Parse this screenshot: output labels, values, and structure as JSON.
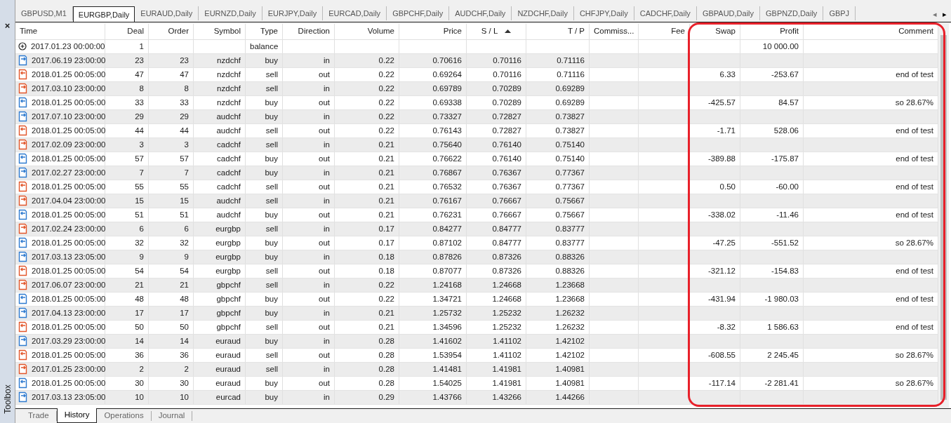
{
  "chart_tabs": [
    {
      "label": "GBPUSD,M1",
      "selected": false
    },
    {
      "label": "EURGBP,Daily",
      "selected": true
    },
    {
      "label": "EURAUD,Daily",
      "selected": false
    },
    {
      "label": "EURNZD,Daily",
      "selected": false
    },
    {
      "label": "EURJPY,Daily",
      "selected": false
    },
    {
      "label": "EURCAD,Daily",
      "selected": false
    },
    {
      "label": "GBPCHF,Daily",
      "selected": false
    },
    {
      "label": "AUDCHF,Daily",
      "selected": false
    },
    {
      "label": "NZDCHF,Daily",
      "selected": false
    },
    {
      "label": "CHFJPY,Daily",
      "selected": false
    },
    {
      "label": "CADCHF,Daily",
      "selected": false
    },
    {
      "label": "GBPAUD,Daily",
      "selected": false
    },
    {
      "label": "GBPNZD,Daily",
      "selected": false
    },
    {
      "label": "GBPJ",
      "selected": false
    }
  ],
  "tab_scroll": {
    "left": "◂",
    "right": "▸"
  },
  "panel": {
    "close": "×",
    "title": "Toolbox"
  },
  "table": {
    "columns": [
      {
        "label": "Time"
      },
      {
        "label": "Deal"
      },
      {
        "label": "Order"
      },
      {
        "label": "Symbol"
      },
      {
        "label": "Type"
      },
      {
        "label": "Direction"
      },
      {
        "label": "Volume"
      },
      {
        "label": "Price"
      },
      {
        "label": "S / L",
        "sorted": true
      },
      {
        "label": "T / P"
      },
      {
        "label": "Commiss..."
      },
      {
        "label": "Fee"
      },
      {
        "label": "Swap"
      },
      {
        "label": "Profit"
      },
      {
        "label": "Comment"
      }
    ],
    "rows": [
      {
        "kind": "balance",
        "time": "2017.01.23 00:00:00",
        "deal": "1",
        "type": "balance",
        "profit": "10 000.00"
      },
      {
        "kind": "deal",
        "time": "2017.06.19 23:00:00",
        "deal": "23",
        "order": "23",
        "symbol": "nzdchf",
        "type": "buy",
        "direction": "in",
        "volume": "0.22",
        "price": "0.70616",
        "sl": "0.70116",
        "tp": "0.71116"
      },
      {
        "kind": "deal",
        "time": "2018.01.25 00:05:00",
        "deal": "47",
        "order": "47",
        "symbol": "nzdchf",
        "type": "sell",
        "direction": "out",
        "volume": "0.22",
        "price": "0.69264",
        "sl": "0.70116",
        "tp": "0.71116",
        "swap": "6.33",
        "profit": "-253.67",
        "comment": "end of test"
      },
      {
        "kind": "deal",
        "time": "2017.03.10 23:00:00",
        "deal": "8",
        "order": "8",
        "symbol": "nzdchf",
        "type": "sell",
        "direction": "in",
        "volume": "0.22",
        "price": "0.69789",
        "sl": "0.70289",
        "tp": "0.69289"
      },
      {
        "kind": "deal",
        "time": "2018.01.25 00:05:00",
        "deal": "33",
        "order": "33",
        "symbol": "nzdchf",
        "type": "buy",
        "direction": "out",
        "volume": "0.22",
        "price": "0.69338",
        "sl": "0.70289",
        "tp": "0.69289",
        "swap": "-425.57",
        "profit": "84.57",
        "comment": "so 28.67%"
      },
      {
        "kind": "deal",
        "time": "2017.07.10 23:00:00",
        "deal": "29",
        "order": "29",
        "symbol": "audchf",
        "type": "buy",
        "direction": "in",
        "volume": "0.22",
        "price": "0.73327",
        "sl": "0.72827",
        "tp": "0.73827"
      },
      {
        "kind": "deal",
        "time": "2018.01.25 00:05:00",
        "deal": "44",
        "order": "44",
        "symbol": "audchf",
        "type": "sell",
        "direction": "out",
        "volume": "0.22",
        "price": "0.76143",
        "sl": "0.72827",
        "tp": "0.73827",
        "swap": "-1.71",
        "profit": "528.06",
        "comment": "end of test"
      },
      {
        "kind": "deal",
        "time": "2017.02.09 23:00:00",
        "deal": "3",
        "order": "3",
        "symbol": "cadchf",
        "type": "sell",
        "direction": "in",
        "volume": "0.21",
        "price": "0.75640",
        "sl": "0.76140",
        "tp": "0.75140"
      },
      {
        "kind": "deal",
        "time": "2018.01.25 00:05:00",
        "deal": "57",
        "order": "57",
        "symbol": "cadchf",
        "type": "buy",
        "direction": "out",
        "volume": "0.21",
        "price": "0.76622",
        "sl": "0.76140",
        "tp": "0.75140",
        "swap": "-389.88",
        "profit": "-175.87",
        "comment": "end of test"
      },
      {
        "kind": "deal",
        "time": "2017.02.27 23:00:00",
        "deal": "7",
        "order": "7",
        "symbol": "cadchf",
        "type": "buy",
        "direction": "in",
        "volume": "0.21",
        "price": "0.76867",
        "sl": "0.76367",
        "tp": "0.77367"
      },
      {
        "kind": "deal",
        "time": "2018.01.25 00:05:00",
        "deal": "55",
        "order": "55",
        "symbol": "cadchf",
        "type": "sell",
        "direction": "out",
        "volume": "0.21",
        "price": "0.76532",
        "sl": "0.76367",
        "tp": "0.77367",
        "swap": "0.50",
        "profit": "-60.00",
        "comment": "end of test"
      },
      {
        "kind": "deal",
        "time": "2017.04.04 23:00:00",
        "deal": "15",
        "order": "15",
        "symbol": "audchf",
        "type": "sell",
        "direction": "in",
        "volume": "0.21",
        "price": "0.76167",
        "sl": "0.76667",
        "tp": "0.75667"
      },
      {
        "kind": "deal",
        "time": "2018.01.25 00:05:00",
        "deal": "51",
        "order": "51",
        "symbol": "audchf",
        "type": "buy",
        "direction": "out",
        "volume": "0.21",
        "price": "0.76231",
        "sl": "0.76667",
        "tp": "0.75667",
        "swap": "-338.02",
        "profit": "-11.46",
        "comment": "end of test"
      },
      {
        "kind": "deal",
        "time": "2017.02.24 23:00:00",
        "deal": "6",
        "order": "6",
        "symbol": "eurgbp",
        "type": "sell",
        "direction": "in",
        "volume": "0.17",
        "price": "0.84277",
        "sl": "0.84777",
        "tp": "0.83777"
      },
      {
        "kind": "deal",
        "time": "2018.01.25 00:05:00",
        "deal": "32",
        "order": "32",
        "symbol": "eurgbp",
        "type": "buy",
        "direction": "out",
        "volume": "0.17",
        "price": "0.87102",
        "sl": "0.84777",
        "tp": "0.83777",
        "swap": "-47.25",
        "profit": "-551.52",
        "comment": "so 28.67%"
      },
      {
        "kind": "deal",
        "time": "2017.03.13 23:05:00",
        "deal": "9",
        "order": "9",
        "symbol": "eurgbp",
        "type": "buy",
        "direction": "in",
        "volume": "0.18",
        "price": "0.87826",
        "sl": "0.87326",
        "tp": "0.88326"
      },
      {
        "kind": "deal",
        "time": "2018.01.25 00:05:00",
        "deal": "54",
        "order": "54",
        "symbol": "eurgbp",
        "type": "sell",
        "direction": "out",
        "volume": "0.18",
        "price": "0.87077",
        "sl": "0.87326",
        "tp": "0.88326",
        "swap": "-321.12",
        "profit": "-154.83",
        "comment": "end of test"
      },
      {
        "kind": "deal",
        "time": "2017.06.07 23:00:00",
        "deal": "21",
        "order": "21",
        "symbol": "gbpchf",
        "type": "sell",
        "direction": "in",
        "volume": "0.22",
        "price": "1.24168",
        "sl": "1.24668",
        "tp": "1.23668"
      },
      {
        "kind": "deal",
        "time": "2018.01.25 00:05:00",
        "deal": "48",
        "order": "48",
        "symbol": "gbpchf",
        "type": "buy",
        "direction": "out",
        "volume": "0.22",
        "price": "1.34721",
        "sl": "1.24668",
        "tp": "1.23668",
        "swap": "-431.94",
        "profit": "-1 980.03",
        "comment": "end of test"
      },
      {
        "kind": "deal",
        "time": "2017.04.13 23:00:00",
        "deal": "17",
        "order": "17",
        "symbol": "gbpchf",
        "type": "buy",
        "direction": "in",
        "volume": "0.21",
        "price": "1.25732",
        "sl": "1.25232",
        "tp": "1.26232"
      },
      {
        "kind": "deal",
        "time": "2018.01.25 00:05:00",
        "deal": "50",
        "order": "50",
        "symbol": "gbpchf",
        "type": "sell",
        "direction": "out",
        "volume": "0.21",
        "price": "1.34596",
        "sl": "1.25232",
        "tp": "1.26232",
        "swap": "-8.32",
        "profit": "1 586.63",
        "comment": "end of test"
      },
      {
        "kind": "deal",
        "time": "2017.03.29 23:00:00",
        "deal": "14",
        "order": "14",
        "symbol": "euraud",
        "type": "buy",
        "direction": "in",
        "volume": "0.28",
        "price": "1.41602",
        "sl": "1.41102",
        "tp": "1.42102"
      },
      {
        "kind": "deal",
        "time": "2018.01.25 00:05:00",
        "deal": "36",
        "order": "36",
        "symbol": "euraud",
        "type": "sell",
        "direction": "out",
        "volume": "0.28",
        "price": "1.53954",
        "sl": "1.41102",
        "tp": "1.42102",
        "swap": "-608.55",
        "profit": "2 245.45",
        "comment": "so 28.67%"
      },
      {
        "kind": "deal",
        "time": "2017.01.25 23:00:00",
        "deal": "2",
        "order": "2",
        "symbol": "euraud",
        "type": "sell",
        "direction": "in",
        "volume": "0.28",
        "price": "1.41481",
        "sl": "1.41981",
        "tp": "1.40981"
      },
      {
        "kind": "deal",
        "time": "2018.01.25 00:05:00",
        "deal": "30",
        "order": "30",
        "symbol": "euraud",
        "type": "buy",
        "direction": "out",
        "volume": "0.28",
        "price": "1.54025",
        "sl": "1.41981",
        "tp": "1.40981",
        "swap": "-117.14",
        "profit": "-2 281.41",
        "comment": "so 28.67%"
      },
      {
        "kind": "deal",
        "time": "2017.03.13 23:05:00",
        "deal": "10",
        "order": "10",
        "symbol": "eurcad",
        "type": "buy",
        "direction": "in",
        "volume": "0.29",
        "price": "1.43766",
        "sl": "1.43266",
        "tp": "1.44266"
      }
    ]
  },
  "bottom_tabs": [
    {
      "label": "Trade",
      "selected": false
    },
    {
      "label": "History",
      "selected": true
    },
    {
      "label": "Operations",
      "selected": false
    },
    {
      "label": "Journal",
      "selected": false
    }
  ]
}
